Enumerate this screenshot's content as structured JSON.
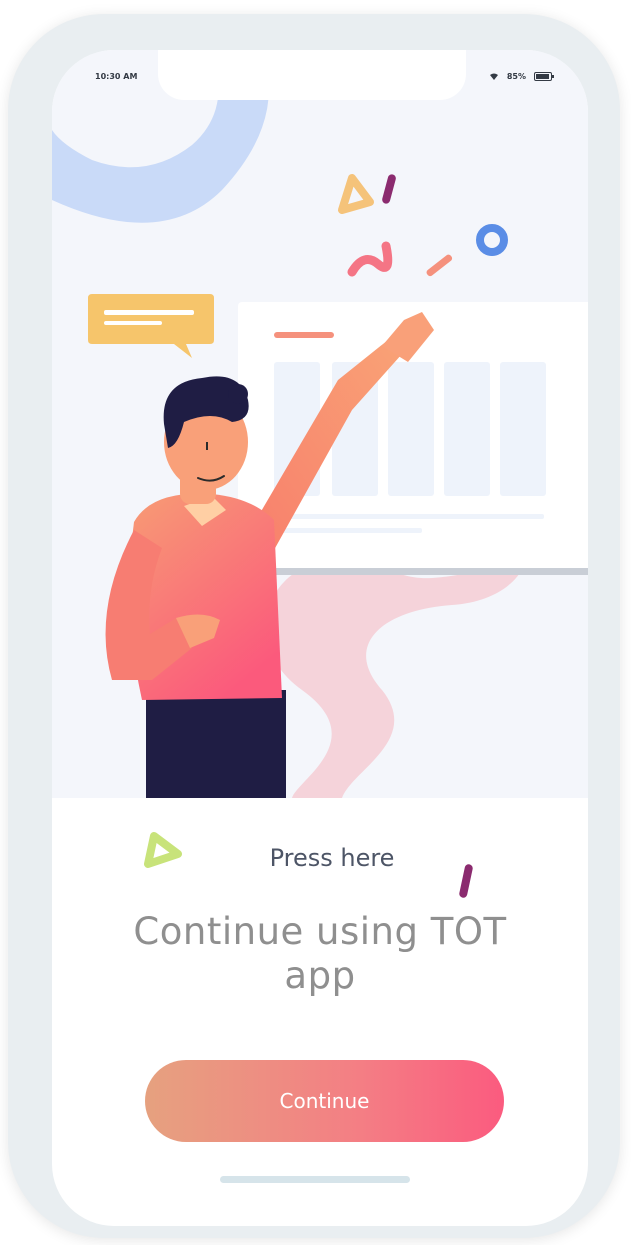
{
  "status_bar": {
    "time": "10:30 AM",
    "battery_percent": "85%",
    "battery_icon": "battery-icon",
    "wifi_icon": "wifi-icon"
  },
  "onboarding": {
    "press_text": "Press here",
    "headline_line1": "Continue using TOT",
    "headline_line2": "app",
    "continue_label": "Continue"
  },
  "colors": {
    "cta_gradient_start": "#e6a17f",
    "cta_gradient_end": "#fb5b7f",
    "hero_background": "#f4f6fb"
  }
}
